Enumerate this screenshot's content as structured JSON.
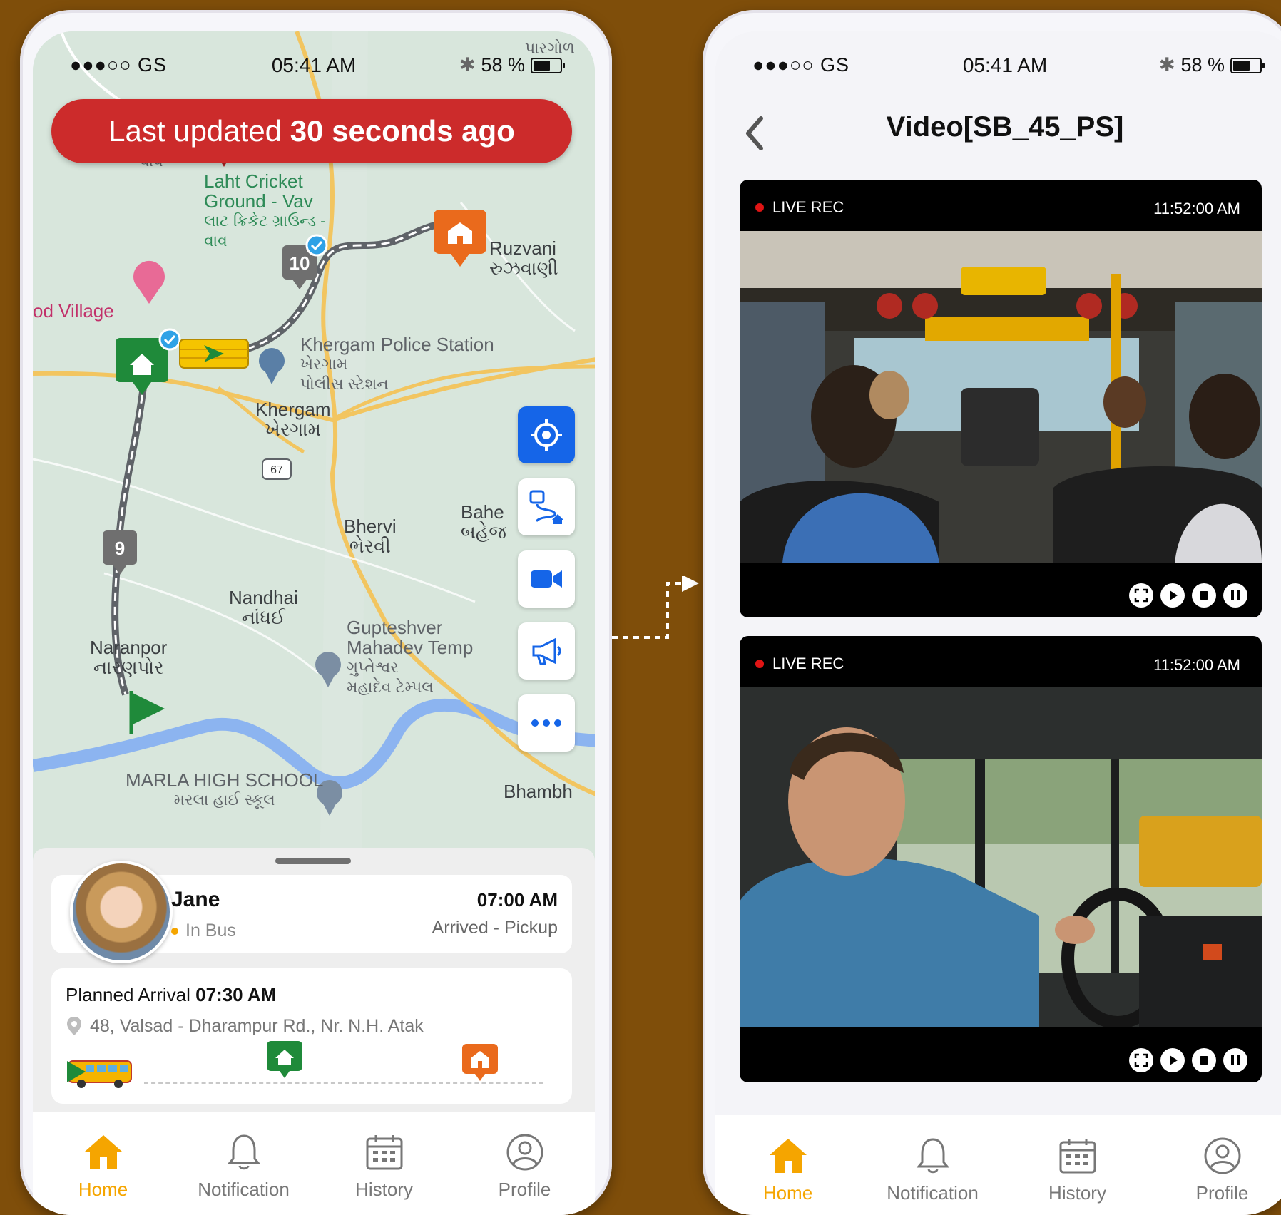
{
  "status_bar": {
    "carrier": "●●●○○ GS",
    "time": "05:41 AM",
    "battery": "58 %"
  },
  "map_screen": {
    "banner_prefix": "Last updated",
    "banner_bold": "30 seconds ago",
    "map_labels": {
      "cricket_en": "Laht Cricket Ground - Vav",
      "cricket_gu": "લાટ ક્રિકેટ ગ્રાઉન્ડ - વાવ",
      "ruzvani_en": "Ruzvani",
      "ruzvani_gu": "રુઝવાણી",
      "village": "od Village",
      "police_en": "Khergam Police Station",
      "police_gu": "ખેરગામ પોલીસ સ્ટેશન",
      "khergam_en": "Khergam",
      "khergam_gu": "ખેરગામ",
      "road_num": "67",
      "bhervi_en": "Bhervi",
      "bhervi_gu": "ભેરવી",
      "bahe_en": "Bahe",
      "bahe_gu": "બહેજ",
      "nandhai_en": "Nandhai",
      "nandhai_gu": "નાંધઈ",
      "naranpor_en": "Naranpor",
      "naranpor_gu": "નારણપોર",
      "temple_en1": "Gupteshver",
      "temple_en2": "Mahadev Temp",
      "temple_gu": "ગુપ્તેશ્વર મહાદેવ ટેમ્પલ",
      "school_en": "MARLA HIGH SCHOOL",
      "school_gu": "મરલા હાઈ સ્કૂલ",
      "bhambh": "Bhambh",
      "top_gu": "પારગોળ",
      "vav_gu": "વાવ"
    },
    "stop_10": "10",
    "stop_9": "9",
    "child": {
      "name": "Jane",
      "status": "In Bus",
      "time": "07:00 AM",
      "event": "Arrived - Pickup"
    },
    "route": {
      "planned_label": "Planned Arrival",
      "planned_time": "07:30 AM",
      "address": "48, Valsad - Dharampur Rd., Nr. N.H. Atak"
    }
  },
  "video_screen": {
    "title": "Video[SB_45_PS]",
    "videos": [
      {
        "rec_label": "LIVE REC",
        "time": "11:52:00 AM"
      },
      {
        "rec_label": "LIVE REC",
        "time": "11:52:00 AM"
      }
    ]
  },
  "tabs": [
    {
      "label": "Home",
      "icon": "home-icon"
    },
    {
      "label": "Notification",
      "icon": "bell-icon"
    },
    {
      "label": "History",
      "icon": "calendar-icon"
    },
    {
      "label": "Profile",
      "icon": "user-icon"
    }
  ],
  "colors": {
    "accent": "#f5a500",
    "banner": "#cc2b2b",
    "primary": "#1565e8",
    "home_marker": "#1f8a3a",
    "school_marker": "#ea6a1c",
    "background": "#7f4e0a"
  }
}
